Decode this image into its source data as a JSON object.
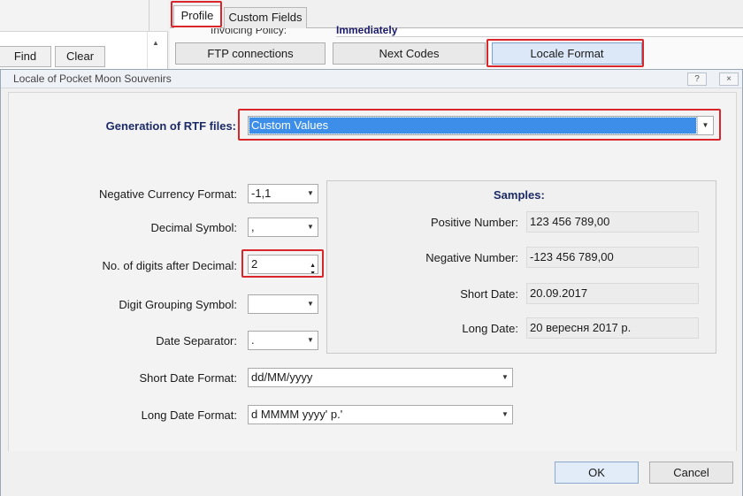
{
  "background": {
    "find_label": "Find",
    "clear_label": "Clear",
    "tabs": [
      "Profile",
      "Custom Fields"
    ],
    "invoicing_policy_label": "Invoicing Policy:",
    "invoicing_policy_value": "Immediately",
    "buttons": [
      "FTP connections",
      "Next Codes",
      "Locale Format"
    ]
  },
  "dialog": {
    "title": "Locale of Pocket Moon Souvenirs",
    "help": "?",
    "close": "×",
    "rtf_label": "Generation of RTF files:",
    "rtf_value": "Custom Values",
    "fields": {
      "negative_currency": {
        "label": "Negative Currency Format:",
        "value": "-1,1"
      },
      "decimal_symbol": {
        "label": "Decimal Symbol:",
        "value": ","
      },
      "digits_after_decimal": {
        "label": "No. of digits after Decimal:",
        "value": "2"
      },
      "digit_grouping": {
        "label": "Digit Grouping Symbol:",
        "value": ""
      },
      "date_separator": {
        "label": "Date Separator:",
        "value": "."
      },
      "short_date_format": {
        "label": "Short Date Format:",
        "value": "dd/MM/yyyy"
      },
      "long_date_format": {
        "label": "Long Date Format:",
        "value": "d MMMM yyyy' р.'"
      }
    },
    "samples": {
      "title": "Samples:",
      "positive_label": "Positive Number:",
      "positive_value": "123 456 789,00",
      "negative_label": "Negative Number:",
      "negative_value": "-123 456 789,00",
      "short_date_label": "Short Date:",
      "short_date_value": "20.09.2017",
      "long_date_label": "Long Date:",
      "long_date_value": "20 вересня 2017 р."
    },
    "ok_label": "OK",
    "cancel_label": "Cancel"
  },
  "colors": {
    "highlight_red": "#d9262a",
    "selection_blue": "#3d8ee8",
    "label_navy": "#1c2a66"
  }
}
